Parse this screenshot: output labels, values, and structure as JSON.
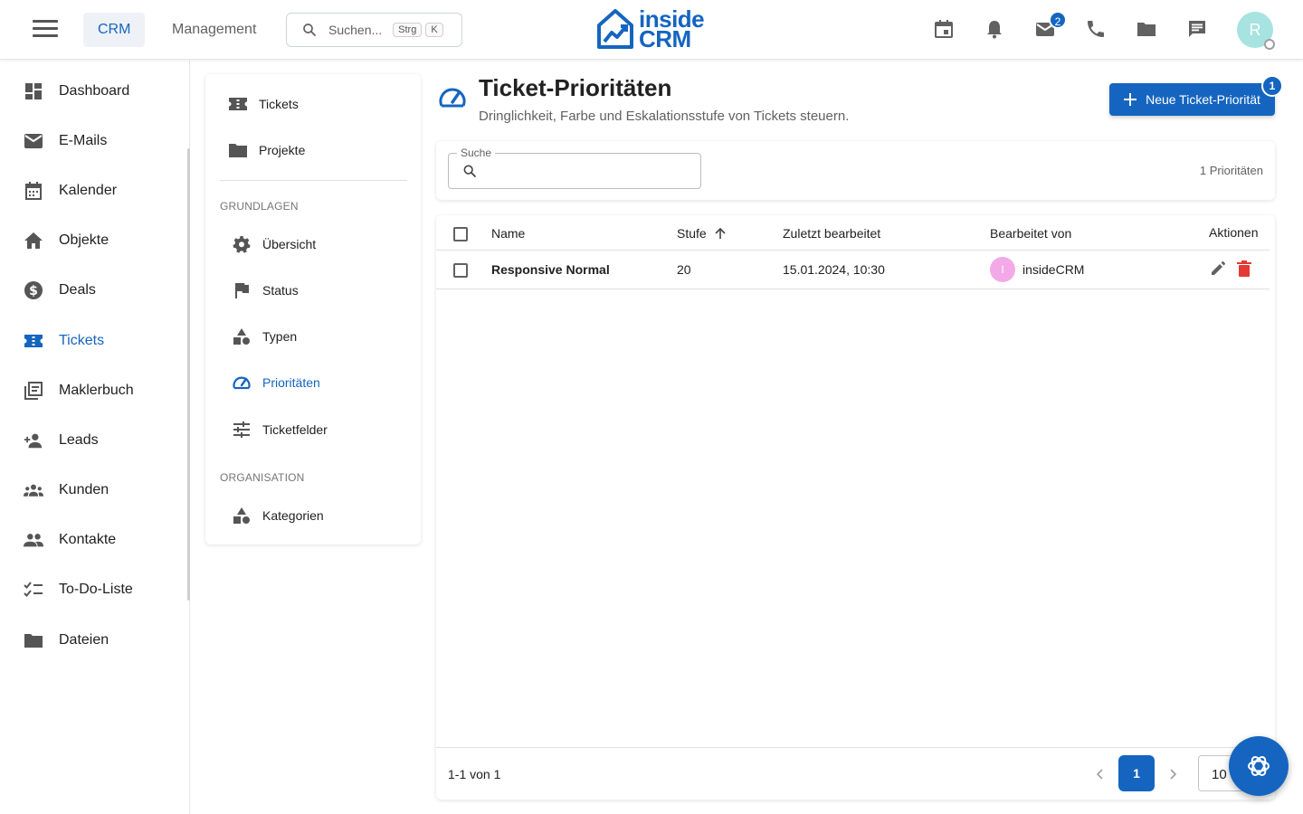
{
  "topbar": {
    "tabs": [
      {
        "label": "CRM"
      },
      {
        "label": "Management"
      }
    ],
    "search": {
      "placeholder": "Suchen...",
      "key1": "Strg",
      "key2": "K"
    },
    "logo": {
      "line1": "inside",
      "line2": "CRM"
    },
    "icons": [
      "calendar-icon",
      "bell-icon",
      "mail-icon",
      "phone-icon",
      "folder-icon",
      "chat-icon"
    ],
    "mail_badge": "2",
    "user_initial": "R"
  },
  "sidebar": {
    "items": [
      {
        "label": "Dashboard",
        "icon": "dashboard-icon"
      },
      {
        "label": "E-Mails",
        "icon": "mail-icon"
      },
      {
        "label": "Kalender",
        "icon": "calendar-icon"
      },
      {
        "label": "Objekte",
        "icon": "home-icon"
      },
      {
        "label": "Deals",
        "icon": "dollar-icon"
      },
      {
        "label": "Tickets",
        "icon": "ticket-icon",
        "active": true
      },
      {
        "label": "Maklerbuch",
        "icon": "library-icon"
      },
      {
        "label": "Leads",
        "icon": "person-add-icon"
      },
      {
        "label": "Kunden",
        "icon": "groups-icon"
      },
      {
        "label": "Kontakte",
        "icon": "people-icon"
      },
      {
        "label": "To-Do-Liste",
        "icon": "checklist-icon"
      },
      {
        "label": "Dateien",
        "icon": "folder-icon"
      }
    ]
  },
  "subnav": {
    "top_items": [
      {
        "label": "Tickets",
        "icon": "ticket-icon"
      },
      {
        "label": "Projekte",
        "icon": "folder-icon"
      }
    ],
    "section1": "GRUNDLAGEN",
    "section1_items": [
      {
        "label": "Übersicht",
        "icon": "gear-icon"
      },
      {
        "label": "Status",
        "icon": "flag-icon"
      },
      {
        "label": "Typen",
        "icon": "category-icon"
      },
      {
        "label": "Prioritäten",
        "icon": "speed-icon",
        "active": true
      },
      {
        "label": "Ticketfelder",
        "icon": "tune-icon"
      }
    ],
    "section2": "ORGANISATION",
    "section2_items": [
      {
        "label": "Kategorien",
        "icon": "category-icon"
      }
    ]
  },
  "main": {
    "title": "Ticket-Prioritäten",
    "subtitle": "Dringlichkeit, Farbe und Eskalationsstufe von Tickets steuern.",
    "new_button": "Neue Ticket-Priorität",
    "new_button_badge": "1",
    "search_label": "Suche",
    "count": "1 Prioritäten"
  },
  "table": {
    "columns": [
      "Name",
      "Stufe",
      "Zuletzt bearbeitet",
      "Bearbeitet von",
      "Aktionen"
    ],
    "rows": [
      {
        "name": "Responsive Normal",
        "level": "20",
        "edited": "15.01.2024, 10:30",
        "editor_initial": "I",
        "editor": "insideCRM"
      }
    ],
    "pagination": {
      "range": "1-1 von 1",
      "page": "1",
      "per_page": "10"
    }
  },
  "colors": {
    "accent": "#1565c0",
    "delete": "#e53935",
    "avatar_row": "#f3a9e8",
    "avatar_user": "#a7e3e0"
  }
}
